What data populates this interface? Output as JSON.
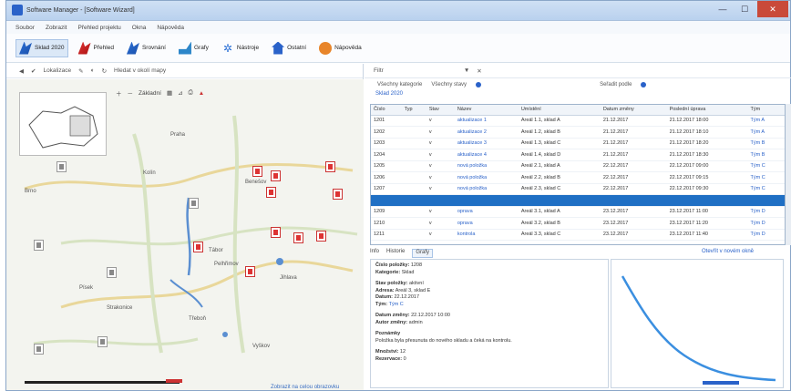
{
  "window": {
    "title": "Software Manager - [Software Wizard]",
    "minimize": "—",
    "maximize": "☐",
    "close": "✕"
  },
  "menu": [
    "Soubor",
    "Zobrazit",
    "Přehled projektu",
    "Okna",
    "Nápověda"
  ],
  "ribbon": [
    {
      "label": "Sklad 2020",
      "icon": "chart-blue-icon",
      "active": true
    },
    {
      "label": "Přehled",
      "icon": "chart-red-icon"
    },
    {
      "label": "Srovnání",
      "icon": "chart-blue-icon"
    },
    {
      "label": "Grafy",
      "icon": "area-chart-icon"
    },
    {
      "label": "Nástroje",
      "icon": "gear-icon"
    },
    {
      "label": "Ostatní",
      "icon": "house-icon"
    },
    {
      "label": "Nápověda",
      "icon": "help-icon"
    }
  ],
  "map_toolbar": {
    "zoom_label": "Lokalizace",
    "search_label": "Hledat v okolí mapy"
  },
  "map_tools": {
    "layer_label": "Základní"
  },
  "map_labels": [
    {
      "text": "Praha"
    },
    {
      "text": "Brno"
    },
    {
      "text": "Kolín"
    },
    {
      "text": "Benešov"
    },
    {
      "text": "Tábor"
    },
    {
      "text": "Pelhřimov"
    },
    {
      "text": "Jihlava"
    },
    {
      "text": "Písek"
    },
    {
      "text": "Strakonice"
    },
    {
      "text": "Třeboň"
    },
    {
      "text": "Vyškov"
    }
  ],
  "map_link": "Zobrazit na celou obrazovku",
  "filter": {
    "label": "Filtr",
    "sub1": "Všechny kategorie",
    "sub2": "Všechny stavy",
    "sub3": "Seřadit podle",
    "tab": "Sklad 2020"
  },
  "grid": {
    "headers": [
      "Číslo",
      "Typ",
      "Stav",
      "Název",
      "Umístění",
      "Datum změny",
      "Poslední úprava",
      "Tým"
    ],
    "rows": [
      [
        "1201",
        "",
        "v",
        "aktualizace 1",
        "Areál 1.1, sklad A",
        "21.12.2017",
        "21.12.2017 18:00",
        "Tým A"
      ],
      [
        "1202",
        "",
        "v",
        "aktualizace 2",
        "Areál 1.2, sklad B",
        "21.12.2017",
        "21.12.2017 18:10",
        "Tým A"
      ],
      [
        "1203",
        "",
        "v",
        "aktualizace 3",
        "Areál 1.3, sklad C",
        "21.12.2017",
        "21.12.2017 18:20",
        "Tým B"
      ],
      [
        "1204",
        "",
        "v",
        "aktualizace 4",
        "Areál 1.4, sklad D",
        "21.12.2017",
        "21.12.2017 18:30",
        "Tým B"
      ],
      [
        "1205",
        "",
        "v",
        "nová položka",
        "Areál 2.1, sklad A",
        "22.12.2017",
        "22.12.2017 09:00",
        "Tým C"
      ],
      [
        "1206",
        "",
        "v",
        "nová položka",
        "Areál 2.2, sklad B",
        "22.12.2017",
        "22.12.2017 09:15",
        "Tým C"
      ],
      [
        "1207",
        "",
        "v",
        "nová položka",
        "Areál 2.3, sklad C",
        "22.12.2017",
        "22.12.2017 09:30",
        "Tým C"
      ],
      [
        "",
        "",
        "",
        "",
        "",
        "",
        "",
        ""
      ],
      [
        "1209",
        "",
        "v",
        "oprava",
        "Areál 3.1, sklad A",
        "23.12.2017",
        "23.12.2017 11:00",
        "Tým D"
      ],
      [
        "1210",
        "",
        "v",
        "oprava",
        "Areál 3.2, sklad B",
        "23.12.2017",
        "23.12.2017 11:20",
        "Tým D"
      ],
      [
        "1211",
        "",
        "v",
        "kontrola",
        "Areál 3.3, sklad C",
        "23.12.2017",
        "23.12.2017 11:40",
        "Tým D"
      ]
    ],
    "selected_row": 7
  },
  "bottom_tabs": [
    "Info",
    "Historie",
    "Grafy"
  ],
  "bottom_link": "Otevřít v novém okně",
  "detail": {
    "line1_label": "Číslo položky:",
    "line1_value": "1208",
    "line2_label": "Kategorie:",
    "line2_value": "Sklad",
    "line3_label": "Stav položky:",
    "line3_value": "aktivní",
    "line4_label": "Adresa:",
    "line4_value": "Areál 3, sklad E",
    "line5_label": "Datum:",
    "line5_value": "22.12.2017",
    "line6_label": "Tým:",
    "line6_value": "Tým C",
    "line7_label": "Datum změny:",
    "line7_value": "22.12.2017 10:00",
    "line8_label": "Autor změny:",
    "line8_value": "admin",
    "section_title": "Poznámky",
    "section_text": "Položka byla přesunuta do nového skladu a čeká na kontrolu.",
    "footer1_label": "Množství:",
    "footer1_value": "12",
    "footer2_label": "Rezervace:",
    "footer2_value": "0"
  }
}
